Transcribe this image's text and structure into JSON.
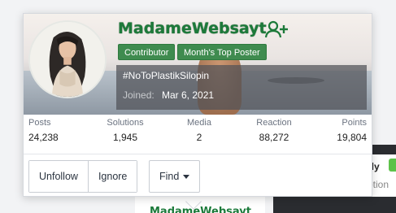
{
  "popup": {
    "username": "MadameWebsayt",
    "badges": [
      "Contributor",
      "Month's Top Poster"
    ],
    "signature": "#NoToPlastikSilopin",
    "joined_label": "Joined:",
    "joined_date": "Mar 6, 2021",
    "stats": [
      {
        "label": "Posts",
        "value": "24,238"
      },
      {
        "label": "Solutions",
        "value": "1,945"
      },
      {
        "label": "Media",
        "value": "2"
      },
      {
        "label": "Reaction",
        "value": "88,272"
      },
      {
        "label": "Points",
        "value": "19,804"
      }
    ],
    "buttons": {
      "unfollow": "Unfollow",
      "ignore": "Ignore",
      "find": "Find"
    },
    "icons": {
      "follow": "user-plus-icon",
      "find_caret": "caret-down-icon"
    }
  },
  "background": {
    "username": "MadameWebsayt",
    "dark_text_1": "rly",
    "dark_text_2": "otion"
  },
  "colors": {
    "username_green": "#1d7a3a",
    "badge_green": "#3f8b4f"
  }
}
